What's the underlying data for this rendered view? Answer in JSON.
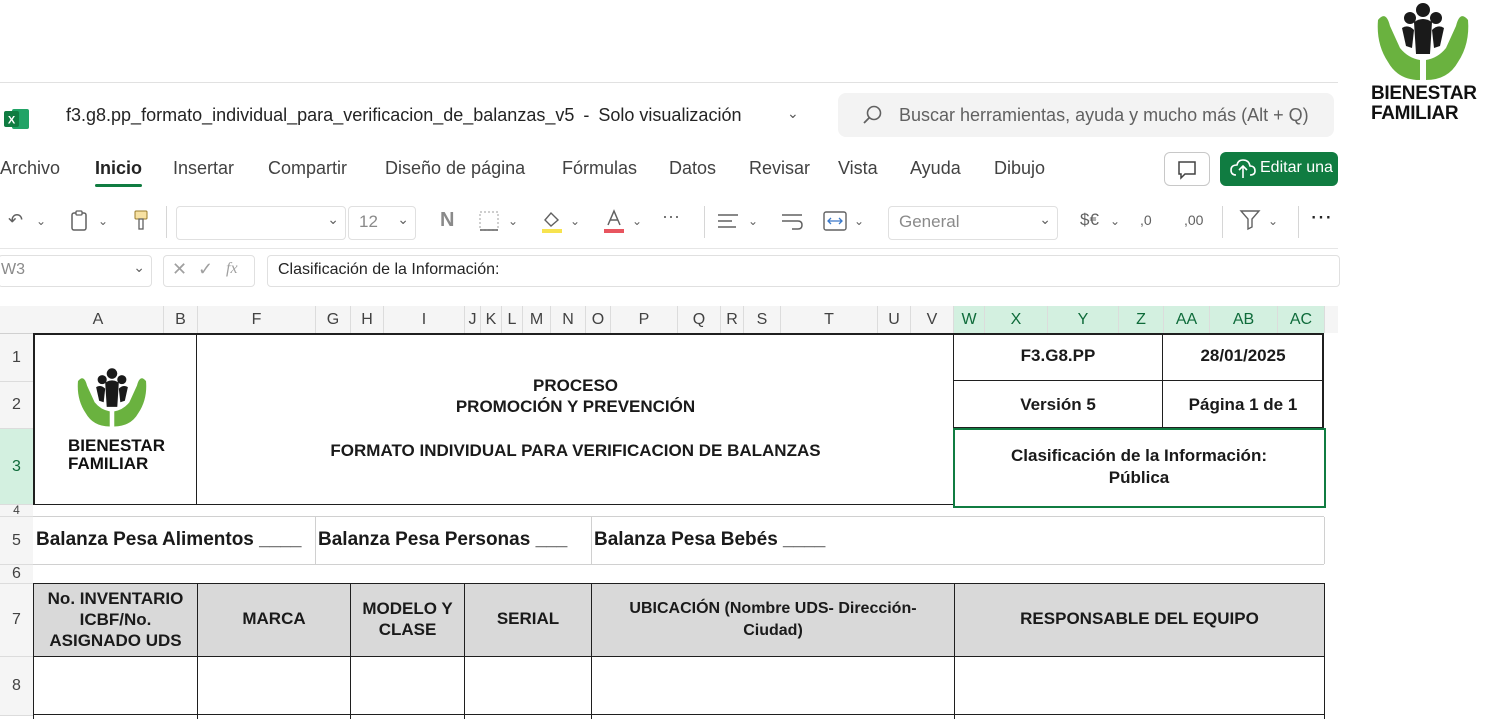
{
  "logo": {
    "text_line1": "BIENESTAR",
    "text_line2": "FAMILIAR"
  },
  "titlebar": {
    "app_icon": "excel-icon",
    "document_title": "f3.g8.pp_formato_individual_para_verificacion_de_balanzas_v5",
    "mode": "Solo visualización",
    "title_separator": "-",
    "search_placeholder": "Buscar herramientas, ayuda y mucho más (Alt + Q)"
  },
  "menu": {
    "tabs": [
      "Archivo",
      "Inicio",
      "Insertar",
      "Compartir",
      "Diseño de página",
      "Fórmulas",
      "Datos",
      "Revisar",
      "Vista",
      "Ayuda",
      "Dibujo"
    ],
    "active_tab": "Inicio",
    "edit_button": "Editar una c"
  },
  "ribbon": {
    "font_size": "12",
    "bold_glyph": "N",
    "number_format": "General",
    "currency_glyph": "$€",
    "more": "···"
  },
  "formula_bar": {
    "name_box": "W3",
    "fx_label": "fx",
    "content": "Clasificación de la Información:"
  },
  "columns": [
    "A",
    "B",
    "F",
    "G",
    "H",
    "I",
    "J",
    "K",
    "L",
    "M",
    "N",
    "O",
    "P",
    "Q",
    "R",
    "S",
    "T",
    "U",
    "V",
    "W",
    "X",
    "Y",
    "Z",
    "AA",
    "AB",
    "AC"
  ],
  "rows": [
    "1",
    "2",
    "3",
    "4",
    "5",
    "6",
    "7",
    "8"
  ],
  "sheet": {
    "proceso": "PROCESO",
    "proceso_nombre": "PROMOCIÓN Y PREVENCIÓN",
    "formato": "FORMATO INDIVIDUAL PARA VERIFICACION DE BALANZAS",
    "codigo": "F3.G8.PP",
    "fecha": "28/01/2025",
    "version": "Versión 5",
    "pagina": "Página 1 de 1",
    "clasificacion_label": "Clasificación de la Información:",
    "clasificacion_valor": "Pública",
    "balanza_alimentos": "Balanza Pesa Alimentos ____",
    "balanza_personas": "Balanza Pesa Personas ___",
    "balanza_bebes": "Balanza Pesa Bebés ____",
    "table_headers": {
      "inventario": [
        "No. INVENTARIO",
        "ICBF/No.",
        "ASIGNADO UDS"
      ],
      "marca": "MARCA",
      "modelo": [
        "MODELO Y",
        "CLASE"
      ],
      "serial": "SERIAL",
      "ubicacion": [
        "UBICACIÓN (Nombre UDS- Dirección-",
        "Ciudad)"
      ],
      "responsable": "RESPONSABLE DEL EQUIPO"
    }
  },
  "colors": {
    "excel_green": "#107c41",
    "logo_green": "#6ab23f",
    "header_gray": "#d9d9d9"
  }
}
